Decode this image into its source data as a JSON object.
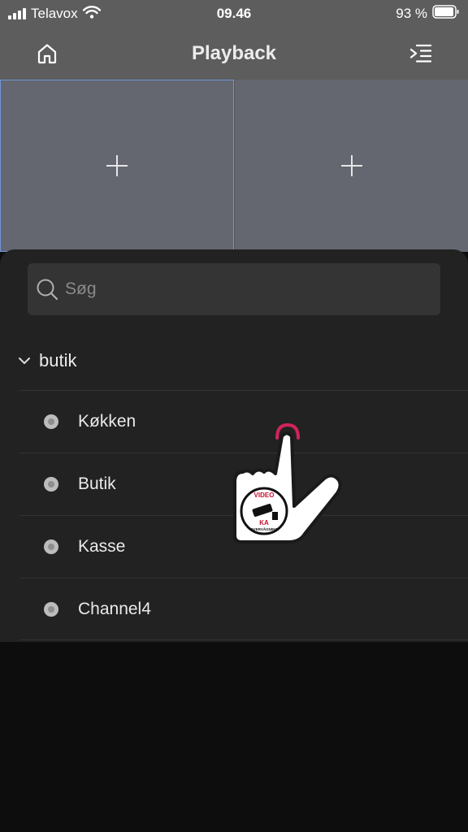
{
  "status": {
    "carrier": "Telavox",
    "time": "09.46",
    "battery": "93 %"
  },
  "nav": {
    "title": "Playback",
    "home_icon": "home-icon",
    "menu_icon": "list-collapse-icon"
  },
  "grid": {
    "cells": [
      {
        "icon": "plus-icon",
        "selected": true
      },
      {
        "icon": "plus-icon",
        "selected": false
      }
    ]
  },
  "search": {
    "placeholder": "Søg",
    "value": ""
  },
  "tree": {
    "group_label": "butik",
    "channels": [
      {
        "label": "Køkken"
      },
      {
        "label": "Butik"
      },
      {
        "label": "Kasse"
      },
      {
        "label": "Channel4"
      }
    ]
  },
  "watermark": {
    "line1": "VIDEO",
    "line2": "KA",
    "line3": "OVERVÅGNING"
  },
  "colors": {
    "header_bg": "#5d5d5d",
    "cell_bg": "#646670",
    "selected_border": "#6f95d6",
    "sheet_bg": "#222222",
    "touch_accent": "#d0245a"
  }
}
